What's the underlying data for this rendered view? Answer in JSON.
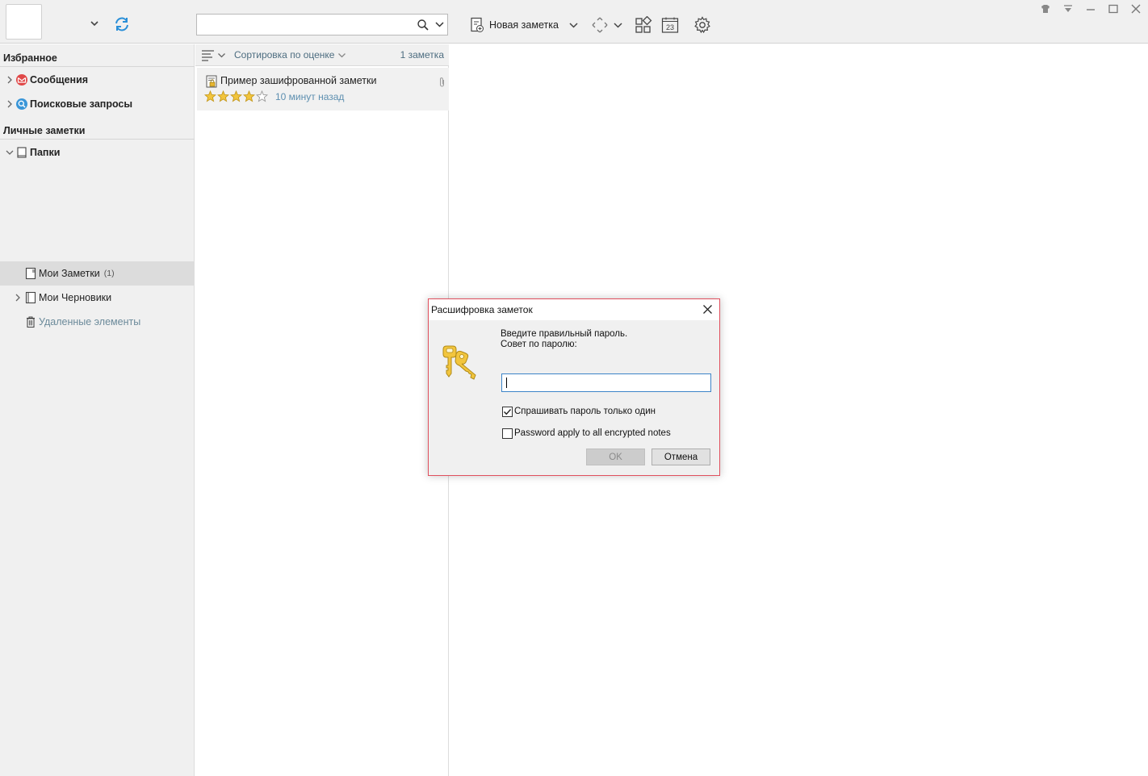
{
  "toolbar": {
    "search_placeholder": "",
    "new_note_label": "Новая заметка"
  },
  "sidebar": {
    "favorites_header": "Избранное",
    "messages_label": "Сообщения",
    "search_queries_label": "Поисковые запросы",
    "personal_header": "Личные заметки",
    "folders_label": "Папки",
    "my_notes_label": "Мои Заметки",
    "my_notes_count": "(1)",
    "my_drafts_label": "Мои Черновики",
    "deleted_label": "Удаленные элементы"
  },
  "note_list": {
    "sort_label": "Сортировка по оценке",
    "count_label": "1 заметка",
    "notes": [
      {
        "title": "Пример зашифрованной заметки",
        "time": "10 минут назад",
        "rating": 4,
        "rating_max": 5
      }
    ]
  },
  "dialog": {
    "title": "Расшифровка заметок",
    "message": "Введите правильный пароль.",
    "hint": "Совет по паролю:",
    "password_value": "",
    "ask_once_label": "Спрашивать пароль только один р",
    "ask_once_checked": true,
    "apply_all_label": "Password apply to all encrypted notes",
    "apply_all_checked": false,
    "ok_label": "OK",
    "cancel_label": "Отмена"
  },
  "colors": {
    "accent_blue": "#3c84c8",
    "dialog_border": "#e0505e",
    "star_gold": "#f2c53d",
    "sync_blue": "#2a8fd8"
  },
  "icons": [
    "chevron-down-icon",
    "sync-icon",
    "search-icon",
    "new-note-icon",
    "expand-icon",
    "layout-icon",
    "calendar-icon",
    "settings-icon",
    "skin-icon",
    "menu-icon",
    "minimize-icon",
    "maximize-icon",
    "close-icon",
    "message-icon",
    "search-query-icon",
    "folder-icon",
    "note-book-icon",
    "draft-icon",
    "trash-icon",
    "sort-icon",
    "encrypted-note-icon",
    "attachment-icon",
    "star-icon",
    "keys-icon"
  ]
}
